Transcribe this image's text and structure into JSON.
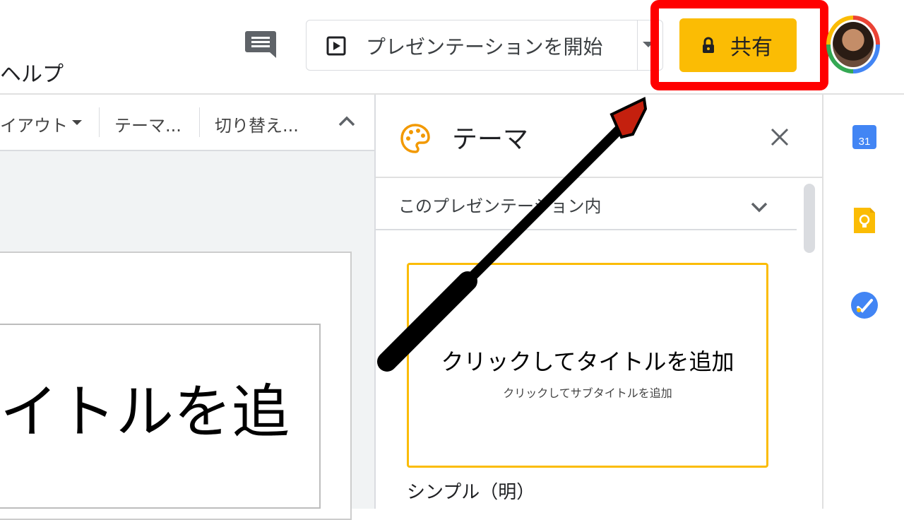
{
  "menu": {
    "help": "ヘルプ"
  },
  "header": {
    "comment_icon": "comment-icon",
    "present_label": "プレゼンテーションを開始",
    "share_label": "共有"
  },
  "toolbar": {
    "layout": "イアウト",
    "theme": "テーマ...",
    "transition": "切り替え..."
  },
  "slide": {
    "title_fragment": "イトルを追"
  },
  "theme_panel": {
    "title": "テーマ",
    "dropdown_label": "このプレゼンテーション内",
    "card_title": "クリックしてタイトルを追加",
    "card_subtitle": "クリックしてサブタイトルを追加",
    "theme_name": "シンプル（明）"
  },
  "colors": {
    "share_button": "#fbbc04",
    "highlight_box": "#ff0000",
    "arrow_head": "#c4200e",
    "selected_card_border": "#fbbc04"
  },
  "side_panel": {
    "icons": [
      "calendar-icon",
      "keep-icon",
      "tasks-icon"
    ]
  },
  "calendar": {
    "day": "31"
  }
}
